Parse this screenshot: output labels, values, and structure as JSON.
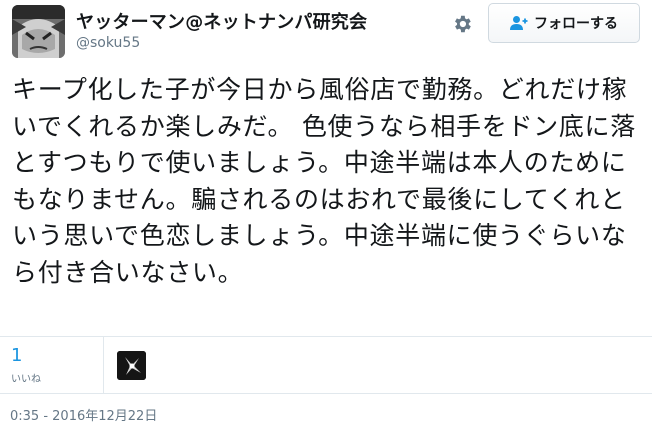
{
  "user": {
    "display_name": "ヤッターマン@ネットナンパ研究会",
    "screen_name": "@soku55"
  },
  "follow_button": {
    "label": "フォローする"
  },
  "tweet": {
    "text": "キープ化した子が今日から風俗店で勤務。どれだけ稼いでくれるか楽しみだ。 色使うなら相手をドン底に落とすつもりで使いましょう。中途半端は本人のためにもなりません。騙されるのはおれで最後にしてくれという思いで色恋しましょう。中途半端に使うぐらいなら付き合いなさい。"
  },
  "stats": {
    "likes_count": "1",
    "likes_label": "いいね"
  },
  "timestamp": "0:35 - 2016年12月22日",
  "colors": {
    "accent": "#1b95e0",
    "muted": "#657786",
    "border": "#e1e8ed"
  },
  "icons": {
    "settings": "gear-icon",
    "follow": "person-plus-icon"
  }
}
